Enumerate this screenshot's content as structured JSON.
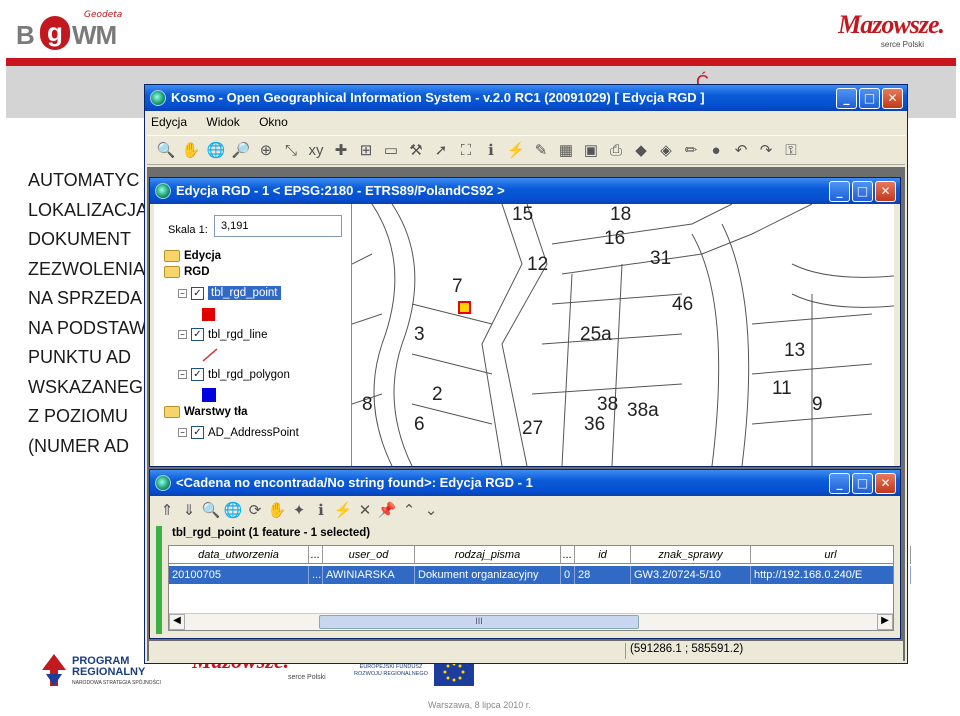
{
  "slide": {
    "logo_left": {
      "small": "Geodeta",
      "b": "B",
      "g": "g",
      "wm": "WM"
    },
    "logo_right": {
      "name": "Mazowsze.",
      "sub": "serce Polski"
    },
    "title_fragment": "Ć",
    "body_lines": [
      "AUTOMATYC",
      "LOKALIZACJA",
      "DOKUMENT",
      "ZEZWOLENIA",
      "NA SPRZEDA",
      "NA PODSTAW",
      "PUNKTU AD",
      "WSKAZANEG",
      "Z POZIOMU",
      "(NUMER AD"
    ],
    "footer_date": "Warszawa, 8 lipca 2010 r.",
    "footer_logos": {
      "program": "PROGRAM\nREGIONALNY",
      "strategia": "NARODOWA STRATEGIA SPÓJNOŚCI",
      "mazowsze": "Mazowsze.",
      "mazowsze_sub": "serce Polski",
      "fund": "EUROPEJSKI FUNDUSZ\nROZWOJU REGIONALNEGO"
    }
  },
  "main_window": {
    "title": "Kosmo - Open Geographical Information System - v.2.0 RC1 (20091029)  [ Edycja RGD ]",
    "menu": [
      "Edycja",
      "Widok",
      "Okno"
    ],
    "toolbar_icons": [
      "zoom-icon",
      "pan-icon",
      "globe-icon",
      "zoom-in-icon",
      "zoom-region-icon",
      "zoom-extent-icon",
      "xy-icon",
      "plus-icon",
      "ide-icon",
      "ruler-icon",
      "hammer-icon",
      "pointer-icon",
      "select-icon",
      "info-icon",
      "lightning-icon",
      "edit-icon",
      "table-icon",
      "layer-icon",
      "print-icon",
      "zoom-in2-icon",
      "zoom-out2-icon",
      "pencil-icon",
      "circle-icon",
      "undo-icon",
      "redo-icon",
      "lock-icon"
    ]
  },
  "rgd_window": {
    "title": "Edycja RGD - 1 < EPSG:2180 - ETRS89/PolandCS92 >",
    "scale_label": "Skala 1:",
    "scale_value": "3,191",
    "tree": {
      "edycja": "Edycja",
      "rgd": "RGD",
      "point": "tbl_rgd_point",
      "line": "tbl_rgd_line",
      "polygon": "tbl_rgd_polygon",
      "warstwy": "Warstwy tła",
      "addr": "AD_AddressPoint"
    },
    "map_labels": [
      "18",
      "16",
      "31",
      "12",
      "7",
      "46",
      "3",
      "25a",
      "13",
      "11",
      "9",
      "2",
      "8",
      "38",
      "38a",
      "6",
      "27",
      "36",
      "15"
    ],
    "colors": {
      "point": "#e00000",
      "polygon": "#0000e0",
      "line": "#d04040"
    }
  },
  "attr_window": {
    "title": "<Cadena no encontrada/No string found>: Edycja RGD - 1",
    "layer_info": "tbl_rgd_point (1 feature - 1 selected)",
    "columns": [
      "data_utworzenia",
      "...",
      "user_od",
      "rodzaj_pisma",
      "...",
      "id",
      "znak_sprawy",
      "url"
    ],
    "row": [
      "20100705",
      "...",
      "AWINIARSKA",
      "Dokument organizacyjny",
      "0",
      "28",
      "GW3.2/0724-5/10",
      "http://192.168.0.240/E"
    ],
    "coords": "(591286.1 ; 585591.2)",
    "scroll_mark": "III"
  }
}
